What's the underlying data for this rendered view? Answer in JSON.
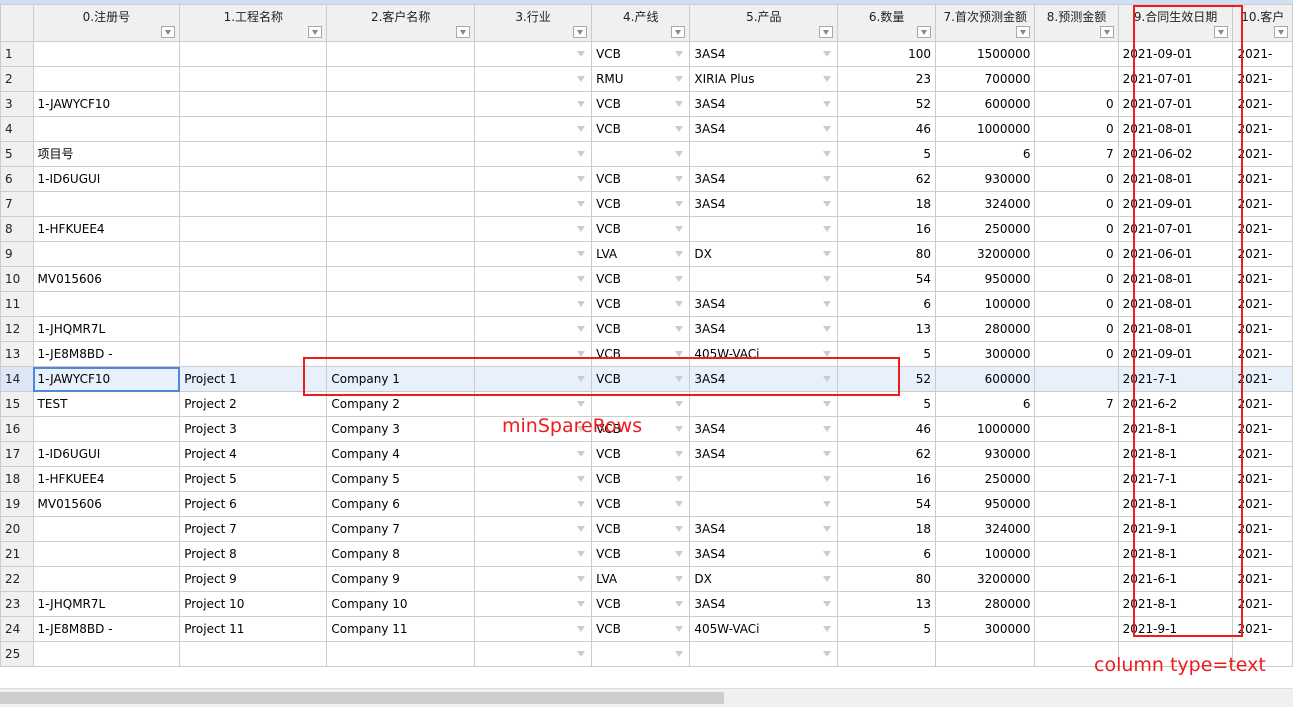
{
  "columns": [
    {
      "label": "0.注册号",
      "type": "text"
    },
    {
      "label": "1.工程名称",
      "type": "text"
    },
    {
      "label": "2.客户名称",
      "type": "text"
    },
    {
      "label": "3.行业",
      "type": "dropdown"
    },
    {
      "label": "4.产线",
      "type": "dropdown"
    },
    {
      "label": "5.产品",
      "type": "dropdown"
    },
    {
      "label": "6.数量",
      "type": "numeric"
    },
    {
      "label": "7.首次预测金额",
      "type": "numeric"
    },
    {
      "label": "8.预测金额",
      "type": "numeric"
    },
    {
      "label": "9.合同生效日期",
      "type": "text"
    },
    {
      "label": "10.客户",
      "type": "text"
    }
  ],
  "rows": [
    {
      "n": "1",
      "c": [
        "",
        "",
        "",
        "",
        "VCB",
        "3AS4",
        "100",
        "1500000",
        "",
        "2021-09-01",
        "2021-"
      ]
    },
    {
      "n": "2",
      "c": [
        "",
        "",
        "",
        "",
        "RMU",
        "XIRIA Plus",
        "23",
        "700000",
        "",
        "2021-07-01",
        "2021-"
      ]
    },
    {
      "n": "3",
      "c": [
        "1-JAWYCF10",
        "",
        "",
        "",
        "VCB",
        "3AS4",
        "52",
        "600000",
        "0",
        "2021-07-01",
        "2021-"
      ]
    },
    {
      "n": "4",
      "c": [
        "",
        "",
        "",
        "",
        "VCB",
        "3AS4",
        "46",
        "1000000",
        "0",
        "2021-08-01",
        "2021-"
      ]
    },
    {
      "n": "5",
      "c": [
        "项目号",
        "",
        "",
        "",
        "",
        "",
        "5",
        "6",
        "7",
        "2021-06-02",
        "2021-"
      ]
    },
    {
      "n": "6",
      "c": [
        "1-ID6UGUI",
        "",
        "",
        "",
        "VCB",
        "3AS4",
        "62",
        "930000",
        "0",
        "2021-08-01",
        "2021-"
      ]
    },
    {
      "n": "7",
      "c": [
        "",
        "",
        "",
        "",
        "VCB",
        "3AS4",
        "18",
        "324000",
        "0",
        "2021-09-01",
        "2021-"
      ]
    },
    {
      "n": "8",
      "c": [
        "1-HFKUEE4",
        "",
        "",
        "",
        "VCB",
        "",
        "16",
        "250000",
        "0",
        "2021-07-01",
        "2021-"
      ]
    },
    {
      "n": "9",
      "c": [
        "",
        "",
        "",
        "",
        "LVA",
        "DX",
        "80",
        "3200000",
        "0",
        "2021-06-01",
        "2021-"
      ]
    },
    {
      "n": "10",
      "c": [
        "MV015606",
        "",
        "",
        "",
        "VCB",
        "",
        "54",
        "950000",
        "0",
        "2021-08-01",
        "2021-"
      ]
    },
    {
      "n": "11",
      "c": [
        "",
        "",
        "",
        "",
        "VCB",
        "3AS4",
        "6",
        "100000",
        "0",
        "2021-08-01",
        "2021-"
      ]
    },
    {
      "n": "12",
      "c": [
        "1-JHQMR7L",
        "",
        "",
        "",
        "VCB",
        "3AS4",
        "13",
        "280000",
        "0",
        "2021-08-01",
        "2021-"
      ]
    },
    {
      "n": "13",
      "c": [
        "1-JE8M8BD -",
        "",
        "",
        "",
        "VCB",
        "405W-VACi",
        "5",
        "300000",
        "0",
        "2021-09-01",
        "2021-"
      ]
    },
    {
      "n": "14",
      "c": [
        "1-JAWYCF10",
        "Project 1",
        "Company 1",
        "",
        "VCB",
        "3AS4",
        "52",
        "600000",
        "",
        "2021-7-1",
        "2021-"
      ]
    },
    {
      "n": "15",
      "c": [
        "TEST",
        "Project 2",
        "Company 2",
        "",
        "",
        "",
        "5",
        "6",
        "7",
        "2021-6-2",
        "2021-"
      ]
    },
    {
      "n": "16",
      "c": [
        "",
        "Project 3",
        "Company 3",
        "",
        "VCB",
        "3AS4",
        "46",
        "1000000",
        "",
        "2021-8-1",
        "2021-"
      ]
    },
    {
      "n": "17",
      "c": [
        "1-ID6UGUI",
        "Project 4",
        "Company 4",
        "",
        "VCB",
        "3AS4",
        "62",
        "930000",
        "",
        "2021-8-1",
        "2021-"
      ]
    },
    {
      "n": "18",
      "c": [
        "1-HFKUEE4",
        "Project 5",
        "Company 5",
        "",
        "VCB",
        "",
        "16",
        "250000",
        "",
        "2021-7-1",
        "2021-"
      ]
    },
    {
      "n": "19",
      "c": [
        "MV015606",
        "Project 6",
        "Company 6",
        "",
        "VCB",
        "",
        "54",
        "950000",
        "",
        "2021-8-1",
        "2021-"
      ]
    },
    {
      "n": "20",
      "c": [
        "",
        "Project 7",
        "Company 7",
        "",
        "VCB",
        "3AS4",
        "18",
        "324000",
        "",
        "2021-9-1",
        "2021-"
      ]
    },
    {
      "n": "21",
      "c": [
        "",
        "Project 8",
        "Company 8",
        "",
        "VCB",
        "3AS4",
        "6",
        "100000",
        "",
        "2021-8-1",
        "2021-"
      ]
    },
    {
      "n": "22",
      "c": [
        "",
        "Project 9",
        "Company 9",
        "",
        "LVA",
        "DX",
        "80",
        "3200000",
        "",
        "2021-6-1",
        "2021-"
      ]
    },
    {
      "n": "23",
      "c": [
        "1-JHQMR7L",
        "Project 10",
        "Company 10",
        "",
        "VCB",
        "3AS4",
        "13",
        "280000",
        "",
        "2021-8-1",
        "2021-"
      ]
    },
    {
      "n": "24",
      "c": [
        "1-JE8M8BD -",
        "Project 11",
        "Company 11",
        "",
        "VCB",
        "405W-VACi",
        "5",
        "300000",
        "",
        "2021-9-1",
        "2021-"
      ]
    },
    {
      "n": "25",
      "c": [
        "",
        "",
        "",
        "",
        "",
        "",
        "",
        "",
        "",
        "",
        ""
      ]
    }
  ],
  "selected_row": "14",
  "annotations": {
    "spare_rows_label": "minSpareRows",
    "column_type_label": "column type=text",
    "color": "#ee1c1c"
  }
}
